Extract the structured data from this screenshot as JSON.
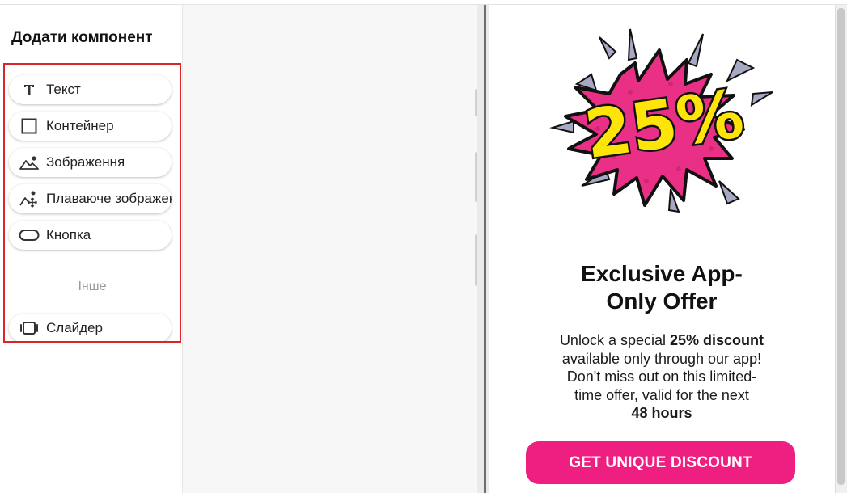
{
  "sidebar": {
    "title": "Додати компонент",
    "items": [
      {
        "label": "Текст",
        "icon": "text-icon"
      },
      {
        "label": "Контейнер",
        "icon": "container-icon"
      },
      {
        "label": "Зображення",
        "icon": "image-icon"
      },
      {
        "label": "Плаваюче зображення",
        "icon": "floating-image-icon"
      },
      {
        "label": "Кнопка",
        "icon": "button-icon"
      }
    ],
    "section_other": "Інше",
    "other_items": [
      {
        "label": "Слайдер",
        "icon": "slider-icon"
      }
    ]
  },
  "preview": {
    "badge_text": "25%",
    "title_line1": "Exclusive App-",
    "title_line2": "Only Offer",
    "body": {
      "l1_before": "Unlock a special ",
      "l1_bold": "25% discount",
      "l2": "available only through our app!",
      "l3": "Don't miss out on this limited-",
      "l4": "time offer, valid for the next",
      "l5_bold": "48 hours"
    },
    "cta_label": "GET UNIQUE DISCOUNT"
  },
  "colors": {
    "highlight_border": "#d9262b",
    "cta_background": "#ef1f82",
    "badge_yellow": "#ffe40a",
    "badge_pink": "#ea2f86",
    "badge_rays": "#a7a9c4"
  }
}
